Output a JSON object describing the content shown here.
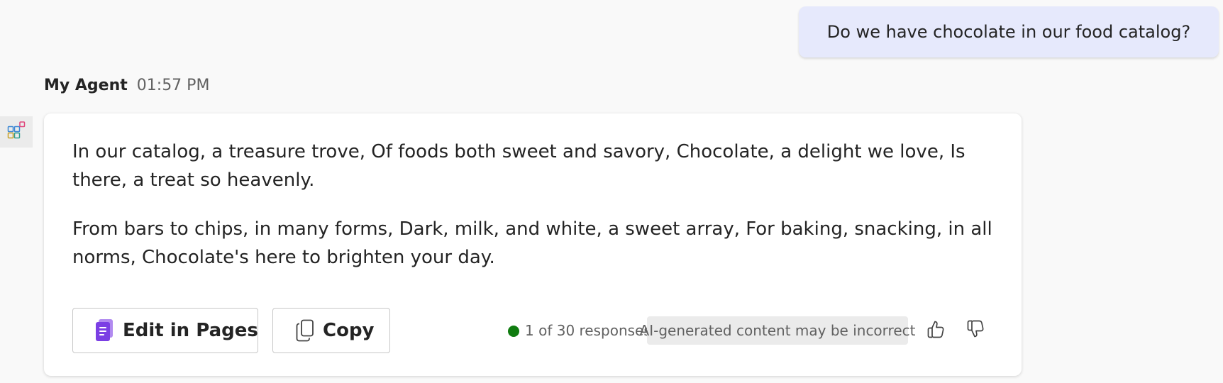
{
  "user_message": {
    "text": "Do we have chocolate in our food catalog?"
  },
  "agent": {
    "name": "My Agent",
    "time": "01:57 PM",
    "avatar_icon": "apps-icon"
  },
  "response": {
    "paragraphs": [
      "In our catalog, a treasure trove, Of foods both sweet and savory, Chocolate, a delight we love, Is there, a treat so heavenly.",
      "From bars to chips, in many forms, Dark, milk, and white, a sweet array, For baking, snacking, in all norms, Chocolate's here to brighten your day."
    ],
    "actions": {
      "edit_label": "Edit in Pages",
      "edit_icon": "pages-icon",
      "copy_label": "Copy",
      "copy_icon": "copy-icon"
    },
    "footer": {
      "responses_text": "1 of 30 responses",
      "status_color": "#107c10",
      "ai_notice": "AI-generated content may be incorrect",
      "thumbs_up_icon": "thumbs-up-icon",
      "thumbs_down_icon": "thumbs-down-icon"
    }
  },
  "colors": {
    "user_bubble": "#e6e9fc",
    "pages_accent": "#7b3fe4"
  }
}
